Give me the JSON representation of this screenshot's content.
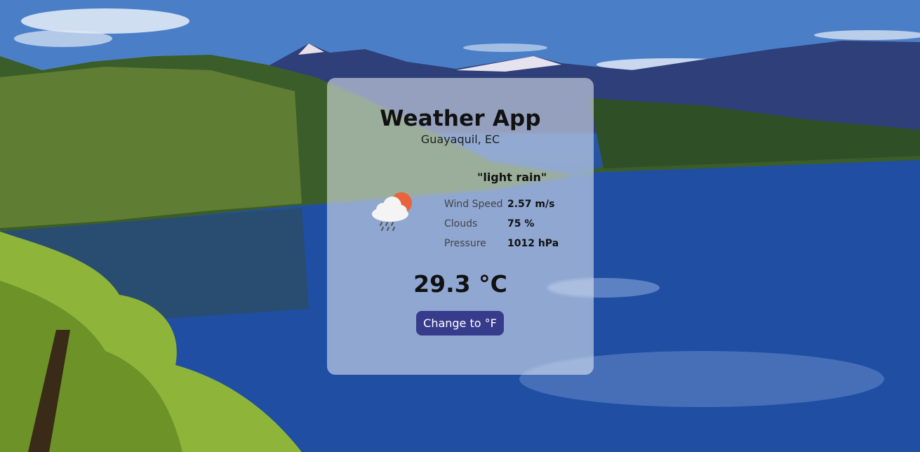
{
  "app": {
    "title": "Weather App",
    "location": "Guayaquil, EC"
  },
  "weather": {
    "description": "\"light rain\"",
    "icon": "cloud-sun-rain-icon",
    "stats": [
      {
        "label": "Wind Speed",
        "value": "2.57 m/s"
      },
      {
        "label": "Clouds",
        "value": "75 %"
      },
      {
        "label": "Pressure",
        "value": "1012 hPa"
      }
    ],
    "temperature": "29.3 °C"
  },
  "controls": {
    "unit_toggle_label": "Change to °F"
  },
  "colors": {
    "button_bg": "#363b8c",
    "card_bg": "rgba(235,240,248,0.55)",
    "sun": "#e8643c"
  }
}
